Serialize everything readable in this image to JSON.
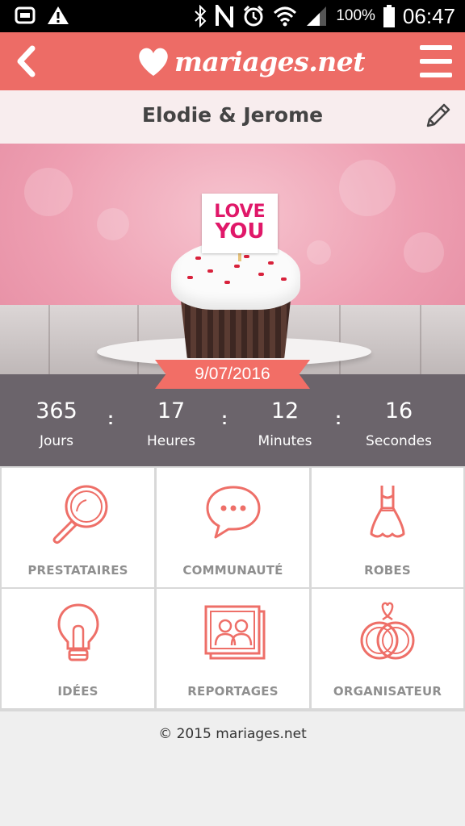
{
  "status_bar": {
    "battery": "100%",
    "time": "06:47",
    "left_icons": [
      "gallery-icon",
      "warning-icon"
    ],
    "right_icons": [
      "bluetooth-icon",
      "nfc-icon",
      "alarm-icon",
      "wifi-icon",
      "signal-icon",
      "battery-icon"
    ]
  },
  "header": {
    "logo_text": "mariages.net",
    "back_icon": "chevron-left-icon",
    "menu_icon": "hamburger-icon",
    "accent_color": "#ed6c66"
  },
  "couple": {
    "names": "Elodie & Jerome",
    "edit_icon": "pencil-icon"
  },
  "hero": {
    "sign_line1": "LOVE",
    "sign_line2": "YOU",
    "date": "9/07/2016"
  },
  "countdown": {
    "items": [
      {
        "value": "365",
        "label": "Jours"
      },
      {
        "value": "17",
        "label": "Heures"
      },
      {
        "value": "12",
        "label": "Minutes"
      },
      {
        "value": "16",
        "label": "Secondes"
      }
    ],
    "separator": ":"
  },
  "tiles": [
    {
      "label": "PRESTATAIRES",
      "icon": "magnifier-icon"
    },
    {
      "label": "COMMUNAUTÉ",
      "icon": "chat-bubble-icon"
    },
    {
      "label": "ROBES",
      "icon": "dress-icon"
    },
    {
      "label": "IDÉES",
      "icon": "lightbulb-icon"
    },
    {
      "label": "REPORTAGES",
      "icon": "photo-album-icon"
    },
    {
      "label": "ORGANISATEUR",
      "icon": "wedding-rings-icon"
    }
  ],
  "footer": {
    "copyright": "© 2015 mariages.net"
  }
}
